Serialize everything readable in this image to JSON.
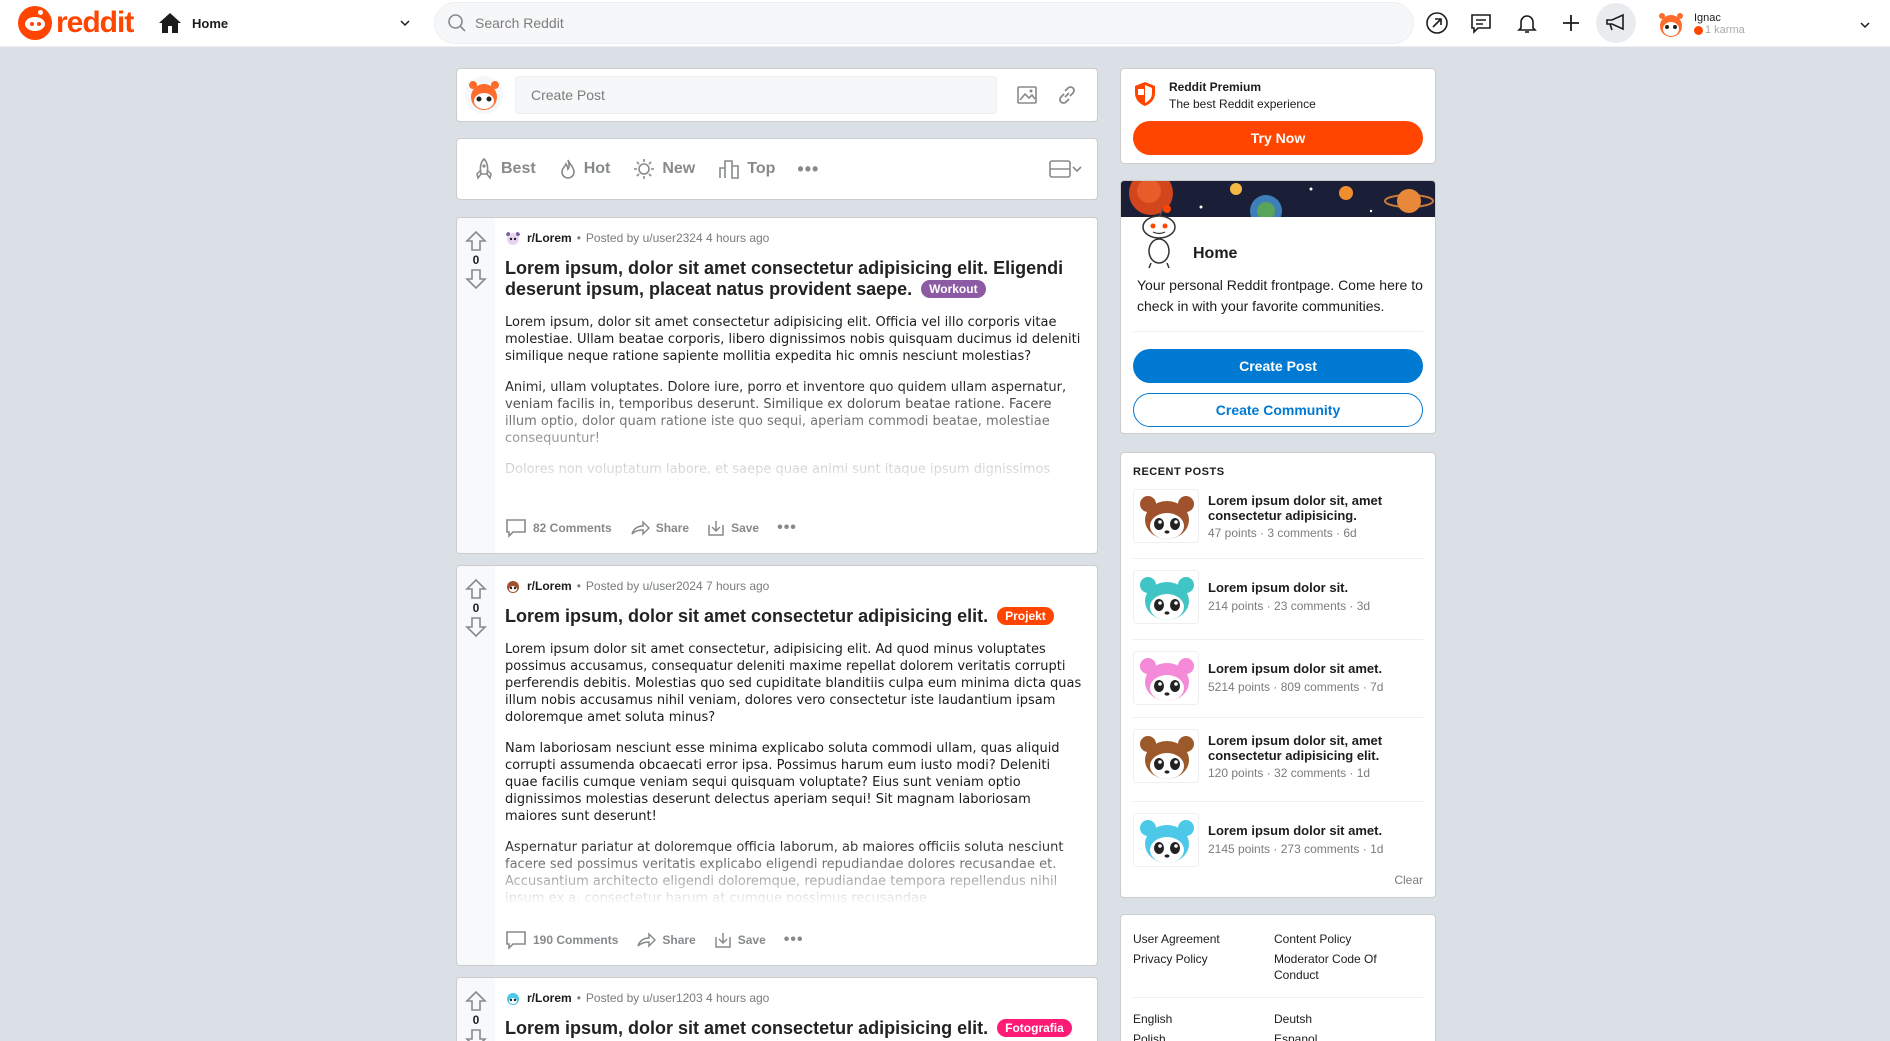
{
  "header": {
    "logo_text": "reddit",
    "home_label": "Home",
    "search_placeholder": "Search Reddit",
    "user": {
      "name": "Ignac",
      "karma": "1 karma"
    }
  },
  "create_post": {
    "placeholder": "Create Post"
  },
  "sort": {
    "items": [
      {
        "label": "Best",
        "icon": "rocket-icon"
      },
      {
        "label": "Hot",
        "icon": "flame-icon"
      },
      {
        "label": "New",
        "icon": "sun-icon"
      },
      {
        "label": "Top",
        "icon": "bar-chart-icon"
      }
    ],
    "more": "•••"
  },
  "posts": [
    {
      "subreddit": "r/Lorem",
      "posted_by": "Posted by u/user2324 4 hours ago",
      "votes": "0",
      "title": "Lorem ipsum, dolor sit amet consectetur adipisicing elit. Eligendi deserunt ipsum, placeat natus provident saepe.",
      "flair": "Workout",
      "flair_color": "#8c5ba3",
      "paragraphs": [
        "Lorem ipsum, dolor sit amet consectetur adipisicing elit. Officia vel illo corporis vitae molestiae. Ullam beatae corporis, libero dignissimos nobis quisquam ducimus id deleniti similique neque ratione sapiente mollitia expedita hic omnis nesciunt molestias?",
        "Animi, ullam voluptates. Dolore iure, porro et inventore quo quidem ullam aspernatur, veniam facilis in, temporibus deserunt. Similique ex dolorum beatae ratione. Facere illum optio, dolor quam ratione iste quo sequi, aperiam commodi beatae, molestiae consequuntur!",
        "Dolores non voluptatum labore, et saepe quae animi sunt itaque ipsum dignissimos"
      ],
      "comments": "82 Comments",
      "share": "Share",
      "save": "Save"
    },
    {
      "subreddit": "r/Lorem",
      "posted_by": "Posted by u/user2024 7 hours ago",
      "votes": "0",
      "title": "Lorem ipsum, dolor sit amet consectetur adipisicing elit.",
      "flair": "Projekt",
      "flair_color": "#ff4500",
      "paragraphs": [
        "Lorem ipsum dolor sit amet consectetur, adipisicing elit. Ad quod minus voluptates possimus accusamus, consequatur deleniti maxime repellat dolorem veritatis corrupti perferendis debitis. Molestias quo sed cupiditate blanditiis culpa eum minima dicta quas illum nobis accusamus nihil veniam, dolores vero consectetur iste laudantium ipsam doloremque amet soluta minus?",
        "Nam laboriosam nesciunt esse minima explicabo soluta commodi ullam, quas aliquid corrupti assumenda obcaecati error ipsa. Possimus harum eum iusto modi? Deleniti quae facilis cumque veniam sequi quisquam voluptate? Eius sunt veniam optio dignissimos molestias deserunt delectus aperiam sequi! Sit magnam laboriosam maiores sunt deserunt!",
        "Aspernatur pariatur at doloremque officia laborum, ab maiores officiis soluta nesciunt facere sed possimus veritatis explicabo eligendi repudiandae dolores recusandae et. Accusantium architecto eligendi doloremque, repudiandae tempora repellendus nihil ipsum ex a, consectetur harum at cumque possimus recusandae"
      ],
      "comments": "190 Comments",
      "share": "Share",
      "save": "Save"
    },
    {
      "subreddit": "r/Lorem",
      "posted_by": "Posted by u/user1203 4 hours ago",
      "votes": "0",
      "title": "Lorem ipsum, dolor sit amet consectetur adipisicing elit.",
      "flair": "Fotografia",
      "flair_color": "#ff1a75"
    }
  ],
  "premium": {
    "title": "Reddit Premium",
    "subtitle": "The best Reddit experience",
    "button": "Try Now"
  },
  "home_card": {
    "title": "Home",
    "description": "Your personal Reddit frontpage. Come here to check in with your favorite communities.",
    "create_post": "Create Post",
    "create_community": "Create Community"
  },
  "recent": {
    "heading": "RECENT POSTS",
    "items": [
      {
        "title": "Lorem ipsum dolor sit, amet consectetur adipisicing.",
        "meta": "47 points · 3 comments · 6d",
        "color": "#a0522d"
      },
      {
        "title": "Lorem ipsum dolor sit.",
        "meta": "214 points · 23 comments · 3d",
        "color": "#40c4c4"
      },
      {
        "title": "Lorem ipsum dolor sit amet.",
        "meta": "5214 points · 809 comments · 7d",
        "color": "#f58ad8"
      },
      {
        "title": "Lorem ipsum dolor sit, amet consectetur adipisicing elit.",
        "meta": "120 points · 32 comments · 1d",
        "color": "#9c5a2b"
      },
      {
        "title": "Lorem ipsum dolor sit amet.",
        "meta": "2145 points · 273 comments · 1d",
        "color": "#4cc8e8"
      }
    ],
    "clear": "Clear"
  },
  "footer": {
    "links": [
      "User Agreement",
      "Content Policy",
      "Privacy Policy",
      "Moderator Code Of Conduct",
      "English",
      "Deutsh",
      "Polish",
      "Espanol"
    ]
  }
}
